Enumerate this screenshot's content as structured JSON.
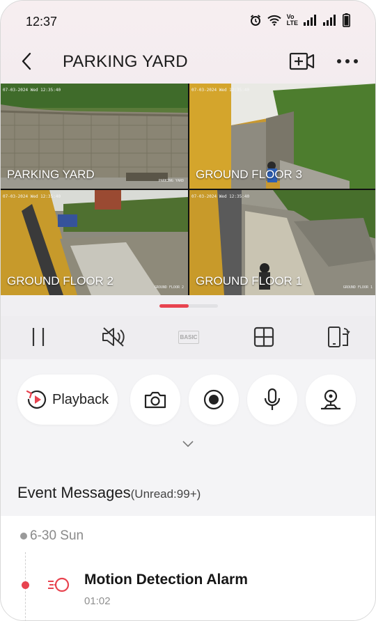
{
  "status_bar": {
    "time": "12:37",
    "icons": [
      "alarm-icon",
      "wifi-icon",
      "volte-icon",
      "signal-icon",
      "signal-icon",
      "battery-icon"
    ],
    "volte_text": "Vo\nLTE"
  },
  "header": {
    "title": "PARKING YARD",
    "back_icon": "chevron-left-icon",
    "add_icon": "add-camera-icon",
    "more_icon": "more-horizontal-icon"
  },
  "cameras": [
    {
      "label": "PARKING YARD",
      "timestamp": "07-03-2024 Wed 12:35:40",
      "watermark": "PARKING YARD",
      "selected": true
    },
    {
      "label": "GROUND FLOOR 3",
      "timestamp": "07-03-2024 Wed 12:35:40",
      "watermark": "",
      "selected": false
    },
    {
      "label": "GROUND FLOOR 2",
      "timestamp": "07-03-2024 Wed 12:35:40",
      "watermark": "GROUND FLOOR 2",
      "selected": false
    },
    {
      "label": "GROUND FLOOR 1",
      "timestamp": "07-03-2024 Wed 12:35:40",
      "watermark": "GROUND FLOOR 1",
      "selected": false
    }
  ],
  "page_indicator": {
    "current": 1,
    "total": 2
  },
  "controls": {
    "pause_icon": "pause-icon",
    "mute_icon": "speaker-muted-icon",
    "quality_label": "BASIC",
    "layout_icon": "grid-layout-icon",
    "rotate_icon": "screen-rotate-icon"
  },
  "actions": {
    "playback_label": "Playback",
    "playback_icon": "playback-icon",
    "snapshot_icon": "camera-icon",
    "record_icon": "record-icon",
    "talk_icon": "microphone-icon",
    "ptz_icon": "ptz-icon",
    "expand_icon": "chevron-down-icon"
  },
  "events": {
    "title": "Event Messages",
    "unread": "(Unread:99+)",
    "date": "6-30 Sun",
    "items": [
      {
        "title": "Motion Detection Alarm",
        "time": "01:02",
        "icon": "motion-alarm-icon"
      }
    ]
  },
  "colors": {
    "accent": "#e8434f",
    "background": "#f4f4f6",
    "header_bg": "#f5edf0"
  }
}
